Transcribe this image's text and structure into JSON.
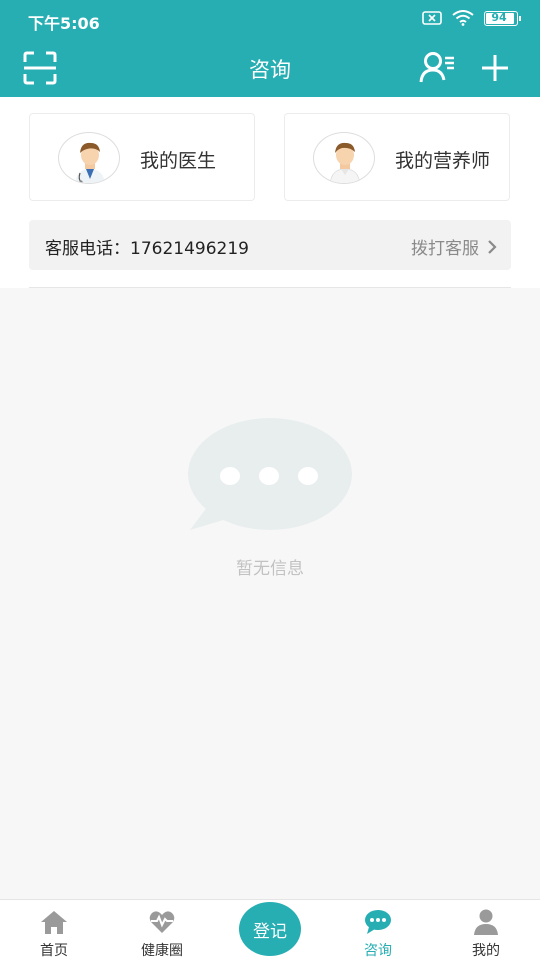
{
  "status_bar": {
    "time": "下午5:06",
    "battery": "94"
  },
  "header": {
    "title": "咨询"
  },
  "cards": {
    "doctor_label": "我的医生",
    "nutritionist_label": "我的营养师"
  },
  "service": {
    "phone_label": "客服电话：17621496219",
    "call_label": "拨打客服"
  },
  "empty_state": {
    "message": "暂无信息"
  },
  "nav": {
    "home": "首页",
    "health": "健康圈",
    "register": "登记",
    "consult": "咨询",
    "me": "我的"
  },
  "colors": {
    "primary": "#26aeb3",
    "background": "#f7f7f7",
    "empty_icon": "#e8eeee"
  }
}
